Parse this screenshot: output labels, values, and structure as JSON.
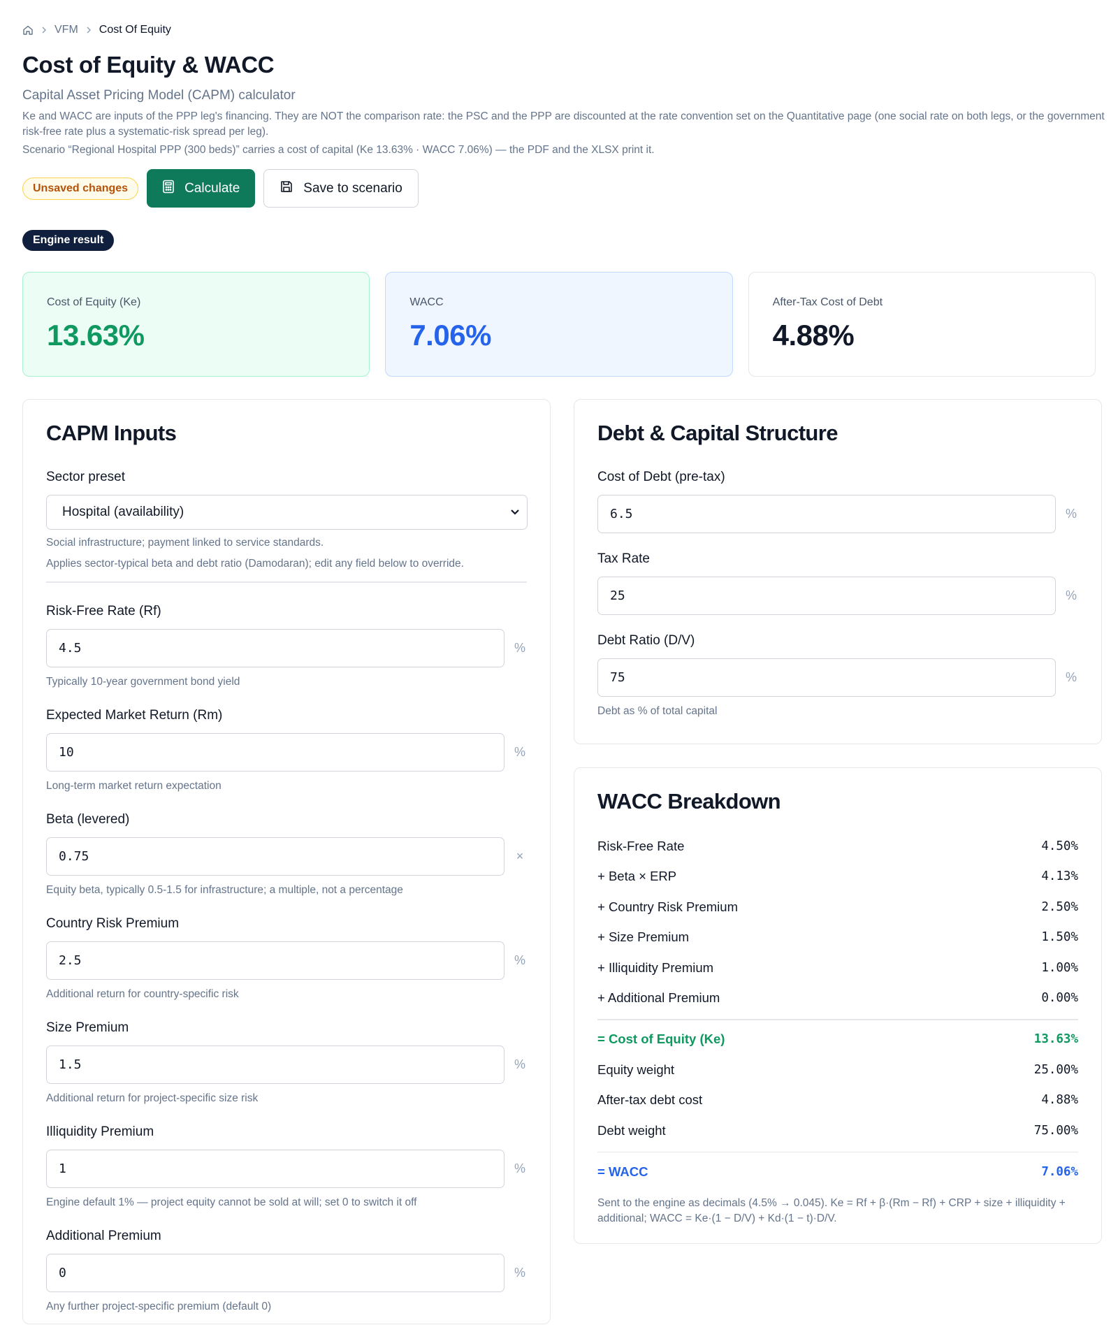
{
  "breadcrumb": {
    "root": "VFM",
    "current": "Cost Of Equity"
  },
  "header": {
    "title": "Cost of Equity & WACC",
    "subtitle": "Capital Asset Pricing Model (CAPM) calculator",
    "description": "Ke and WACC are inputs of the PPP leg's financing. They are NOT the comparison rate: the PSC and the PPP are discounted at the rate convention set on the Quantitative page (one social rate on both legs, or the government risk-free rate plus a systematic-risk spread per leg).",
    "scenario_note": "Scenario “Regional Hospital PPP (300 beds)” carries a cost of capital (Ke 13.63% · WACC 7.06%) — the PDF and the XLSX print it."
  },
  "actions": {
    "unsaved_badge": "Unsaved changes",
    "calculate_label": "Calculate",
    "save_label": "Save to scenario"
  },
  "engine_pill": "Engine result",
  "kpis": {
    "ke": {
      "label": "Cost of Equity (Ke)",
      "value": "13.63%"
    },
    "wacc": {
      "label": "WACC",
      "value": "7.06%"
    },
    "kd": {
      "label": "After-Tax Cost of Debt",
      "value": "4.88%"
    }
  },
  "capm": {
    "title": "CAPM Inputs",
    "sector": {
      "label": "Sector preset",
      "value": "Hospital (availability)",
      "help1": "Social infrastructure; payment linked to service standards.",
      "help2": "Applies sector-typical beta and debt ratio (Damodaran); edit any field below to override."
    },
    "rf": {
      "label": "Risk-Free Rate (Rf)",
      "value": "4.5",
      "unit": "%",
      "help": "Typically 10-year government bond yield"
    },
    "rm": {
      "label": "Expected Market Return (Rm)",
      "value": "10",
      "unit": "%",
      "help": "Long-term market return expectation"
    },
    "beta": {
      "label": "Beta (levered)",
      "value": "0.75",
      "unit": "×",
      "help": "Equity beta, typically 0.5-1.5 for infrastructure; a multiple, not a percentage"
    },
    "crp": {
      "label": "Country Risk Premium",
      "value": "2.5",
      "unit": "%",
      "help": "Additional return for country-specific risk"
    },
    "size": {
      "label": "Size Premium",
      "value": "1.5",
      "unit": "%",
      "help": "Additional return for project-specific size risk"
    },
    "illiq": {
      "label": "Illiquidity Premium",
      "value": "1",
      "unit": "%",
      "help": "Engine default 1% — project equity cannot be sold at will; set 0 to switch it off"
    },
    "addl": {
      "label": "Additional Premium",
      "value": "0",
      "unit": "%",
      "help": "Any further project-specific premium (default 0)"
    }
  },
  "debt": {
    "title": "Debt & Capital Structure",
    "kd": {
      "label": "Cost of Debt (pre-tax)",
      "value": "6.5",
      "unit": "%"
    },
    "tax": {
      "label": "Tax Rate",
      "value": "25",
      "unit": "%"
    },
    "ratio": {
      "label": "Debt Ratio (D/V)",
      "value": "75",
      "unit": "%",
      "help": "Debt as % of total capital"
    }
  },
  "breakdown": {
    "title": "WACC Breakdown",
    "rows": [
      {
        "label": "Risk-Free Rate",
        "value": "4.50%"
      },
      {
        "label": "+ Beta × ERP",
        "value": "4.13%"
      },
      {
        "label": "+ Country Risk Premium",
        "value": "2.50%"
      },
      {
        "label": "+ Size Premium",
        "value": "1.50%"
      },
      {
        "label": "+ Illiquidity Premium",
        "value": "1.00%"
      },
      {
        "label": "+ Additional Premium",
        "value": "0.00%"
      }
    ],
    "ke": {
      "label": "= Cost of Equity (Ke)",
      "value": "13.63%"
    },
    "rows2": [
      {
        "label": "Equity weight",
        "value": "25.00%"
      },
      {
        "label": "After-tax debt cost",
        "value": "4.88%"
      },
      {
        "label": "Debt weight",
        "value": "75.00%"
      }
    ],
    "wacc": {
      "label": "= WACC",
      "value": "7.06%"
    },
    "note": "Sent to the engine as decimals (4.5% → 0.045). Ke = Rf + β·(Rm − Rf) + CRP + size + illiquidity + additional; WACC = Ke·(1 − D/V) + Kd·(1 − t)·D/V."
  }
}
